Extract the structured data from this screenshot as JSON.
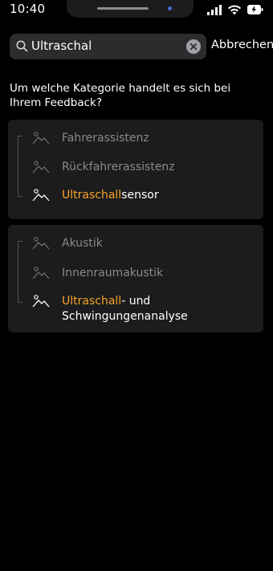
{
  "status": {
    "time": "10:40"
  },
  "search": {
    "query": "Ultraschal",
    "cancel_label": "Abbrechen"
  },
  "question": "Um welche Kategorie handelt es sich bei Ihrem Feedback?",
  "groups": [
    {
      "items": [
        {
          "label": "Fahrerassistenz"
        },
        {
          "label": "Rückfahrerassistenz"
        },
        {
          "match": "Ultraschall",
          "rest": "sensor"
        }
      ]
    },
    {
      "items": [
        {
          "label": "Akustik"
        },
        {
          "label": "Innenraumakustik"
        },
        {
          "match": "Ultraschall",
          "rest": "- und",
          "rest_line2": "Schwingungenanalyse"
        }
      ]
    }
  ],
  "colors": {
    "highlight": "#f5a623",
    "dim_text": "#8a8a8e",
    "card_bg": "#1c1c1e",
    "search_bg": "#2c2c2e"
  }
}
